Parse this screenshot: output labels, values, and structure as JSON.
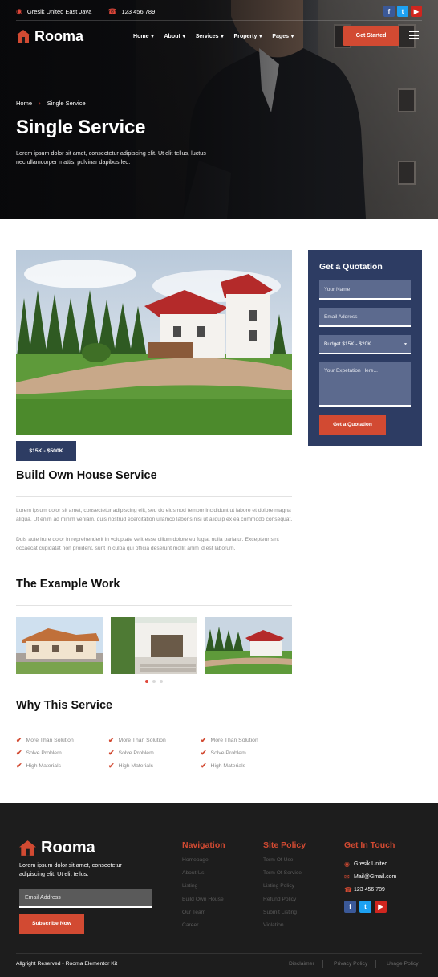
{
  "topbar": {
    "address": "Gresik United East Java",
    "phone": "123 456 789",
    "social": [
      "facebook-icon",
      "twitter-icon",
      "youtube-icon"
    ]
  },
  "nav": {
    "brand": "Rooma",
    "items": [
      {
        "label": "Home"
      },
      {
        "label": "About"
      },
      {
        "label": "Services"
      },
      {
        "label": "Property"
      },
      {
        "label": "Pages"
      }
    ],
    "cta": "Get Started"
  },
  "hero": {
    "breadcrumb": [
      "Home",
      "Single Service"
    ],
    "title": "Single Service",
    "lead": "Lorem ipsum dolor sit amet, consectetur adipiscing elit. Ut elit tellus, luctus nec ullamcorper mattis, pulvinar dapibus leo."
  },
  "service": {
    "price": "$15K - $500K",
    "title": "Build Own House Service",
    "para1": "Lorem ipsum dolor sit amet, consectetur adipiscing elit, sed do eiusmod tempor incididunt ut labore et dolore magna aliqua. Ut enim ad minim veniam, quis nostrud exercitation ullamco laboris nisi ut aliquip ex ea commodo consequat.",
    "para2": "Duis aute irure dolor in reprehenderit in voluptate velit esse cillum dolore eu fugiat nulla pariatur. Excepteur sint occaecat cupidatat non proident, sunt in culpa qui officia deserunt mollit anim id est laborum.",
    "example_title": "The Example Work",
    "why_title": "Why This Service",
    "checks": [
      "More Than Solution",
      "More Than Solution",
      "More Than Solution",
      "Solve Problem",
      "Solve Problem",
      "Solve Problem",
      "High Materials",
      "High Materials",
      "High Materials"
    ]
  },
  "quote": {
    "title": "Get a Quotation",
    "name_placeholder": "Your Name",
    "email_placeholder": "Email Address",
    "budget_value": "Budget $15K - $20K",
    "message_placeholder": "Your Expetation Here...",
    "button": "Get a Quotation"
  },
  "footer": {
    "brand": "Rooma",
    "text": "Lorem ipsum dolor sit amet, consectetur adipiscing elit. Ut elit tellus.",
    "email_placeholder": "Email Address",
    "subscribe": "Subscribe Now",
    "navigation": {
      "title": "Navigation",
      "links": [
        "Homepage",
        "About Us",
        "Listing",
        "Build Own House",
        "Our Team",
        "Career"
      ]
    },
    "policy": {
      "title": "Site Policy",
      "links": [
        "Term Of Use",
        "Term Of Service",
        "Listing Policy",
        "Refund Policy",
        "Submit Listing",
        "Violation"
      ]
    },
    "contact": {
      "title": "Get In Touch",
      "address": "Gresik United",
      "email": "Mail@Gmail.com",
      "phone": "123 456 789"
    },
    "copyright": "Allgright Reserved - Rooma Elementor Kit",
    "bottom_links": [
      "Disclaimer",
      "Privacy Policy",
      "Usage Policy"
    ]
  },
  "colors": {
    "accent": "#d24a32",
    "navy": "#2d3c63",
    "footer_bg": "#1d1d1d"
  }
}
